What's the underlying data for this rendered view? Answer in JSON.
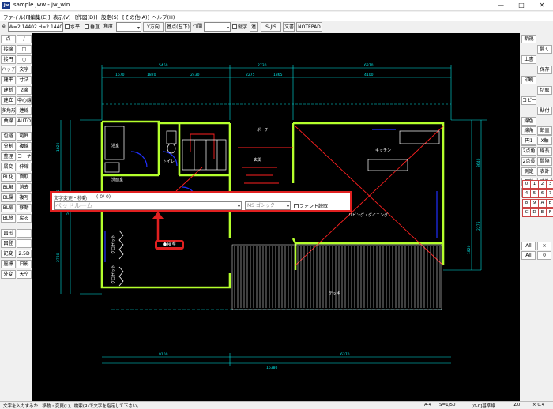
{
  "window": {
    "title": "sample.jww - jw_win",
    "app_icon": "jw",
    "controls": [
      "minimize",
      "maximize",
      "close"
    ]
  },
  "menu": [
    "ファイル(F)",
    "[編集(E)]",
    "表示(V)",
    "[作図(D)]",
    "設定(S)",
    "[その他(A)]",
    "ヘルプ(H)"
  ],
  "toolbar": {
    "prefix": "e",
    "scale_field": "W=2.14402 H=2.14402 D=0",
    "horizontal_label": "水平",
    "vertical_label": "垂直",
    "angle_label": "角度",
    "direction_button": "Y方向",
    "base_button": "基点(左下)",
    "line_spacing_label": "行間",
    "vertical_text_label": "縦字",
    "continue_button": "連",
    "sjis_button": "S-JIS",
    "bunsho_button": "文書",
    "notepad_button": "NOTEPAD"
  },
  "left_tools": [
    [
      "点",
      "/"
    ],
    [
      "接線",
      "□"
    ],
    [
      "接円",
      "○"
    ],
    [
      "ハッチ",
      "文字"
    ],
    [
      "建平",
      "寸法"
    ],
    [
      "建断",
      "2線"
    ],
    [
      "建立",
      "中心線"
    ],
    [
      "多角形",
      "連線"
    ],
    [
      "曲線",
      "AUTO"
    ],
    [
      "包絡",
      "範囲"
    ],
    [
      "分割",
      "複線"
    ],
    [
      "整理",
      "コーナー"
    ],
    [
      "属変",
      "伸縮"
    ],
    [
      "BL化",
      "面取"
    ],
    [
      "BL解",
      "消去"
    ],
    [
      "BL属",
      "複写"
    ],
    [
      "BL編",
      "移動"
    ],
    [
      "BL終",
      "戻る"
    ],
    [
      "図形",
      ""
    ],
    [
      "図登",
      ""
    ],
    [
      "記変",
      "2.5D"
    ],
    [
      "座標",
      "日影"
    ],
    [
      "外変",
      "天空"
    ]
  ],
  "right_tools": [
    [
      "線角",
      "鉛直"
    ],
    [
      "円1",
      "X軸"
    ],
    [
      "2点角",
      "線長"
    ],
    [
      "2点長",
      "間隔"
    ],
    [
      "測定",
      "表計"
    ],
    [
      "距離",
      "式計"
    ],
    [
      "外部",
      "パラメ"
    ]
  ],
  "right_top_tools": [
    [
      "新規",
      "開く"
    ],
    [
      "上書",
      "保存"
    ],
    [
      "印刷",
      "切取"
    ],
    [
      "コピー",
      "貼付"
    ],
    [
      "線色",
      "寸化"
    ],
    [
      "寸解",
      "追加"
    ]
  ],
  "layer_numbers": [
    "0",
    "1",
    "2",
    "3",
    "4",
    "5",
    "6",
    "7",
    "8",
    "9",
    "A",
    "B",
    "C",
    "D",
    "E",
    "F"
  ],
  "layer_buttons": [
    "All",
    "×",
    "All",
    "0"
  ],
  "dialog": {
    "title": "文字変更・移動",
    "counter": "( 0/ 0)",
    "text_value": "ベッドルーム",
    "font": "MS ゴシック",
    "font_read_label": "フォント読取"
  },
  "callout": {
    "label": "寝室"
  },
  "plan_labels": {
    "porch": "ポーチ",
    "kitchen": "キッチン",
    "living": "リビング・ダイニング",
    "toilet": "トイレ",
    "washroom": "洗面室",
    "entrance": "玄関",
    "deck": "デッキ",
    "closet1": "クロゼット",
    "closet2": "クロゼット",
    "bath": "浴室",
    "dims_top": [
      "5460",
      "2730",
      "6370"
    ],
    "dims_second": [
      "1670",
      "1820",
      "2430",
      "2275",
      "1365",
      "4100"
    ],
    "dims_bottom": [
      "9100",
      "6370"
    ],
    "dims_total": "16380",
    "dims_left": [
      "1820",
      "3185",
      "5005",
      "2730"
    ],
    "dims_right": [
      "3640",
      "2275",
      "1820"
    ]
  },
  "status": {
    "message": "文字を入力するか、移動・変更(L)、検索(R)で文字を指定して下さい。",
    "sheet": "A-4",
    "scale": "S=1/50",
    "layer_status": "[0-0]基準線",
    "angle": "∠0",
    "zoom": "× 0.4"
  },
  "colors": {
    "canvas": "#000000",
    "wall": "#b4ff2c",
    "dimension": "#00e5e5",
    "red_line": "#ff2020",
    "door": "#2030ff",
    "dialog_border": "#e02020"
  }
}
